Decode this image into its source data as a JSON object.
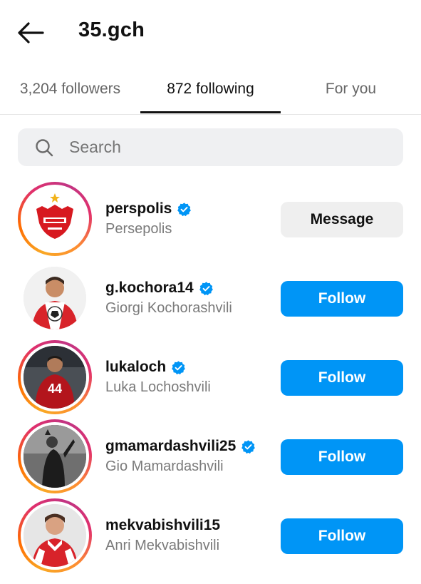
{
  "header": {
    "title": "35.gch"
  },
  "tabs": [
    {
      "label": "3,204 followers",
      "active": false
    },
    {
      "label": "872 following",
      "active": true
    },
    {
      "label": "For you",
      "active": false
    }
  ],
  "search": {
    "placeholder": "Search",
    "value": ""
  },
  "accounts": [
    {
      "username": "perspolis",
      "full_name": "Persepolis",
      "verified": true,
      "button": "Message",
      "story_ring": true
    },
    {
      "username": "g.kochora14",
      "full_name": "Giorgi Kochorashvili",
      "verified": true,
      "button": "Follow",
      "story_ring": false
    },
    {
      "username": "lukaloch",
      "full_name": "Luka Lochoshvili",
      "verified": true,
      "button": "Follow",
      "story_ring": true
    },
    {
      "username": "gmamardashvili25",
      "full_name": "Gio Mamardashvili",
      "verified": true,
      "button": "Follow",
      "story_ring": true
    },
    {
      "username": "mekvabishvili15",
      "full_name": "Anri Mekvabishvili",
      "verified": false,
      "button": "Follow",
      "story_ring": true
    }
  ],
  "colors": {
    "follow_button": "#0095f6",
    "message_button": "#efefef",
    "verified_badge": "#0095f6"
  },
  "icons": {
    "back": "arrow-left-icon",
    "search": "search-icon",
    "verified": "verified-badge-icon"
  }
}
